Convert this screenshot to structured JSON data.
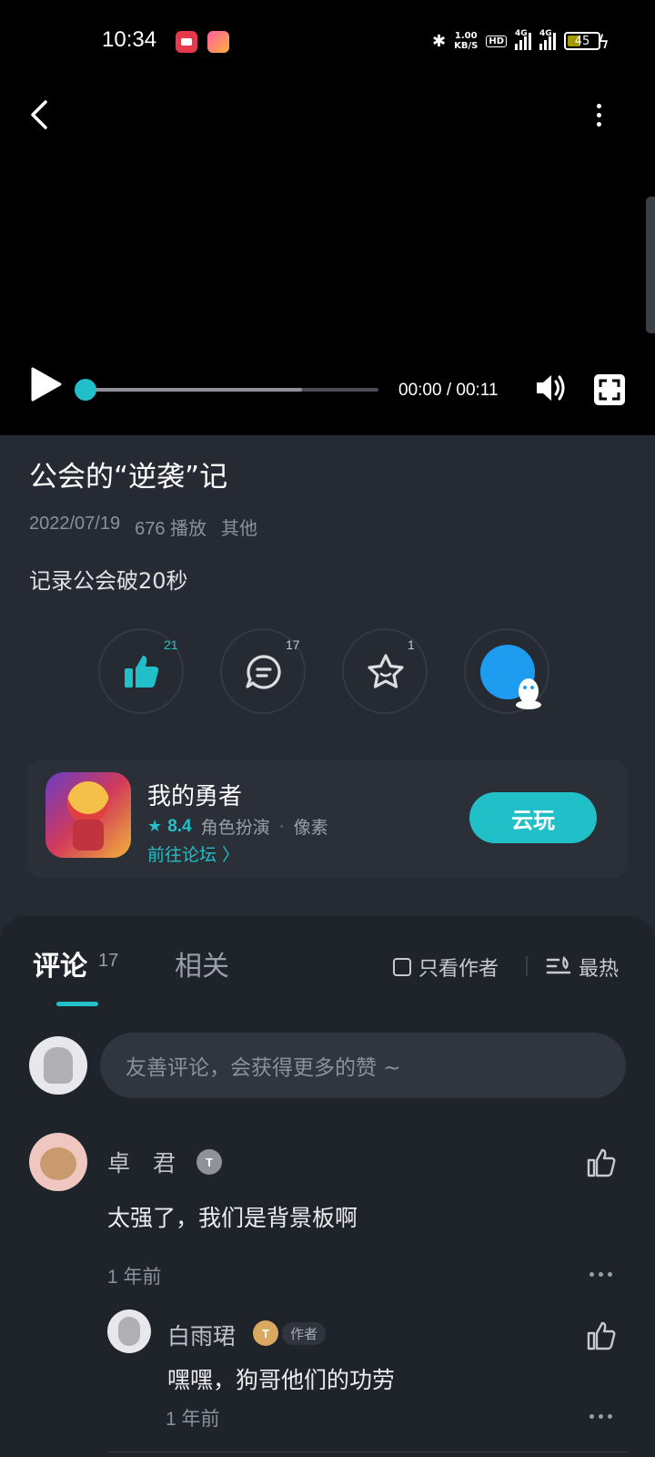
{
  "status_bar": {
    "time": "10:34",
    "speed_value": "1.00",
    "speed_unit": "KB/S",
    "hd_label": "HD",
    "network": "4G",
    "battery": "45"
  },
  "video": {
    "time": "00:00 / 00:11",
    "progress": 0.0,
    "buffered": 0.74
  },
  "post": {
    "title": "公会的“逆袭”记",
    "date": "2022/07/19",
    "plays": "676 播放",
    "category": "其他",
    "description": "记录公会破20秒"
  },
  "actions": {
    "like_count": "21",
    "comment_count": "17",
    "favorite_count": "1"
  },
  "game": {
    "name": "我的勇者",
    "rating": "8.4",
    "tag1": "角色扮演",
    "separator": "·",
    "tag2": "像素",
    "forum_link": "前往论坛 〉",
    "cloud_button": "云玩"
  },
  "comments_header": {
    "tab_comments": "评论",
    "comments_count": "17",
    "tab_related": "相关",
    "only_author": "只看作者",
    "sort": "最热"
  },
  "comment_input": {
    "placeholder": "友善评论，会获得更多的赞 ~"
  },
  "comments": [
    {
      "name": "卓　君",
      "badge": "T",
      "text": "太强了，我们是背景板啊",
      "time": "1 年前"
    }
  ],
  "reply": {
    "name": "白雨珺",
    "badge": "T",
    "author_tag": "作者",
    "text": "嘿嘿，狗哥他们的功劳",
    "time": "1 年前"
  },
  "colors": {
    "accent": "#21c0c8",
    "background": "#262a33",
    "sheet": "#1f232a",
    "qq_blue": "#1e9cf0"
  }
}
